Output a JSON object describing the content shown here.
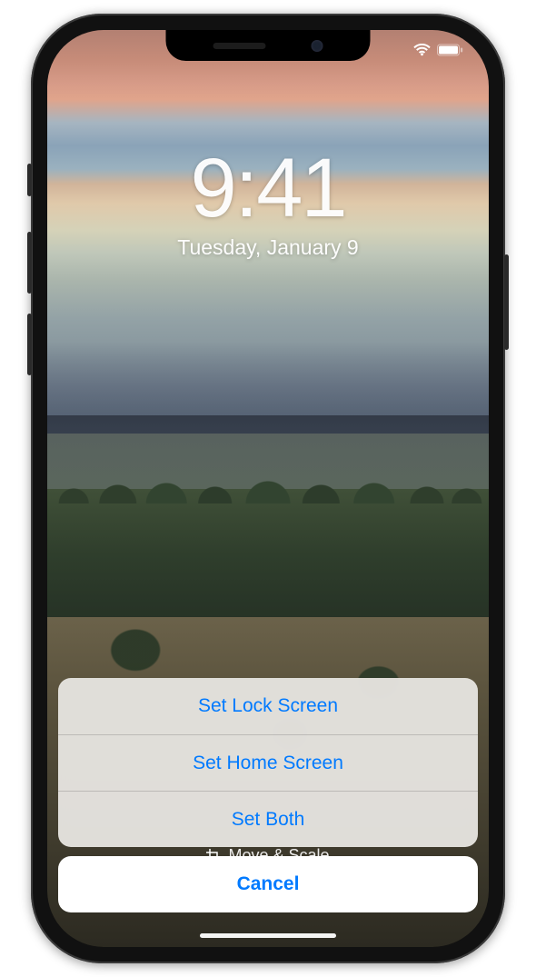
{
  "status": {
    "wifi": true,
    "battery_pct": 100
  },
  "lockscreen": {
    "time": "9:41",
    "date": "Tuesday, January 9"
  },
  "toolbar": {
    "move_scale_label": "Move & Scale"
  },
  "action_sheet": {
    "options": [
      {
        "label": "Set Lock Screen"
      },
      {
        "label": "Set Home Screen"
      },
      {
        "label": "Set Both"
      }
    ],
    "cancel_label": "Cancel"
  },
  "colors": {
    "ios_blue": "#007aff"
  }
}
